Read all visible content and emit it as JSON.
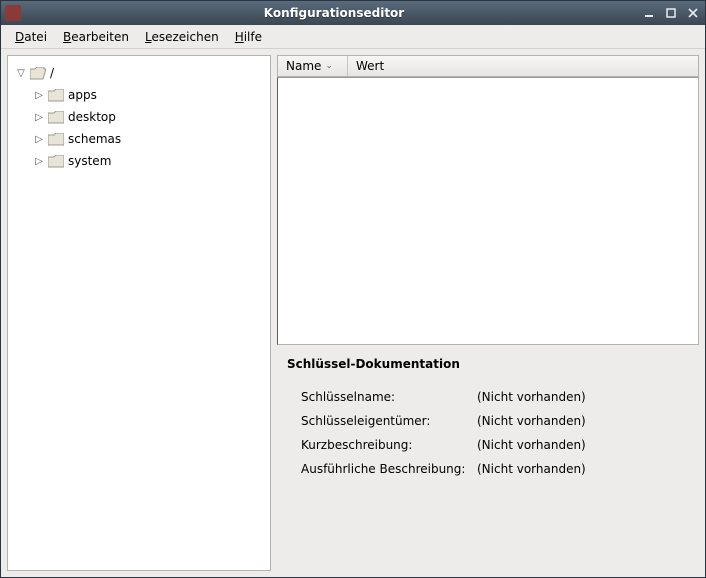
{
  "window": {
    "title": "Konfigurationseditor"
  },
  "menubar": {
    "file": "Datei",
    "edit": "Bearbeiten",
    "bookmarks": "Lesezeichen",
    "help": "Hilfe"
  },
  "tree": {
    "root": "/",
    "items": [
      {
        "label": "apps"
      },
      {
        "label": "desktop"
      },
      {
        "label": "schemas"
      },
      {
        "label": "system"
      }
    ]
  },
  "list": {
    "col_name": "Name",
    "col_value": "Wert"
  },
  "doc": {
    "heading": "Schlüssel-Dokumentation",
    "key_name_label": "Schlüsselname:",
    "key_owner_label": "Schlüsseleigentümer:",
    "short_desc_label": "Kurzbeschreibung:",
    "long_desc_label": "Ausführliche Beschreibung:",
    "none": "(Nicht vorhanden)"
  }
}
